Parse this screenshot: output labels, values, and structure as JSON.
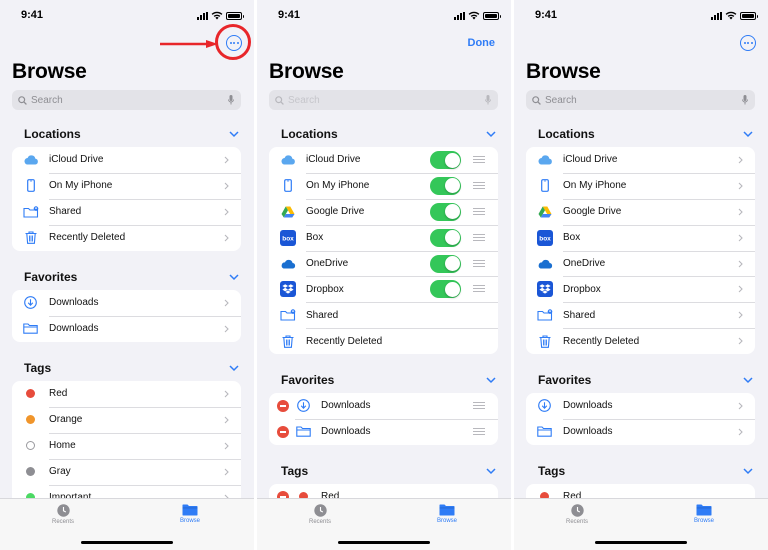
{
  "status": {
    "time": "9:41"
  },
  "header": {
    "title": "Browse",
    "search_placeholder": "Search",
    "done_label": "Done"
  },
  "sections": {
    "locations": "Locations",
    "favorites": "Favorites",
    "tags": "Tags"
  },
  "locations_normal": [
    {
      "label": "iCloud Drive",
      "icon": "icloud-icon"
    },
    {
      "label": "On My iPhone",
      "icon": "iphone-icon"
    },
    {
      "label": "Shared",
      "icon": "shared-folder-icon"
    },
    {
      "label": "Recently Deleted",
      "icon": "trash-icon"
    }
  ],
  "locations_all": [
    {
      "label": "iCloud Drive",
      "icon": "icloud-icon"
    },
    {
      "label": "On My iPhone",
      "icon": "iphone-icon"
    },
    {
      "label": "Google Drive",
      "icon": "google-drive-icon"
    },
    {
      "label": "Box",
      "icon": "box-icon",
      "badge": "box"
    },
    {
      "label": "OneDrive",
      "icon": "onedrive-icon"
    },
    {
      "label": "Dropbox",
      "icon": "dropbox-icon"
    },
    {
      "label": "Shared",
      "icon": "shared-folder-icon"
    },
    {
      "label": "Recently Deleted",
      "icon": "trash-icon"
    }
  ],
  "favorites": [
    {
      "label": "Downloads",
      "icon": "download-circle-icon"
    },
    {
      "label": "Downloads",
      "icon": "folder-icon"
    }
  ],
  "tags": [
    {
      "label": "Red",
      "color": "#e74c3c"
    },
    {
      "label": "Orange",
      "color": "#f0952b"
    },
    {
      "label": "Home",
      "color": "#ffffff"
    },
    {
      "label": "Gray",
      "color": "#8e8e93"
    },
    {
      "label": "Important",
      "color": "#4cd964"
    }
  ],
  "tabbar": {
    "recents": "Recents",
    "browse": "Browse"
  },
  "colors": {
    "accent": "#2f7cf6",
    "toggle_on": "#34c759",
    "annotation": "#e8262a"
  }
}
